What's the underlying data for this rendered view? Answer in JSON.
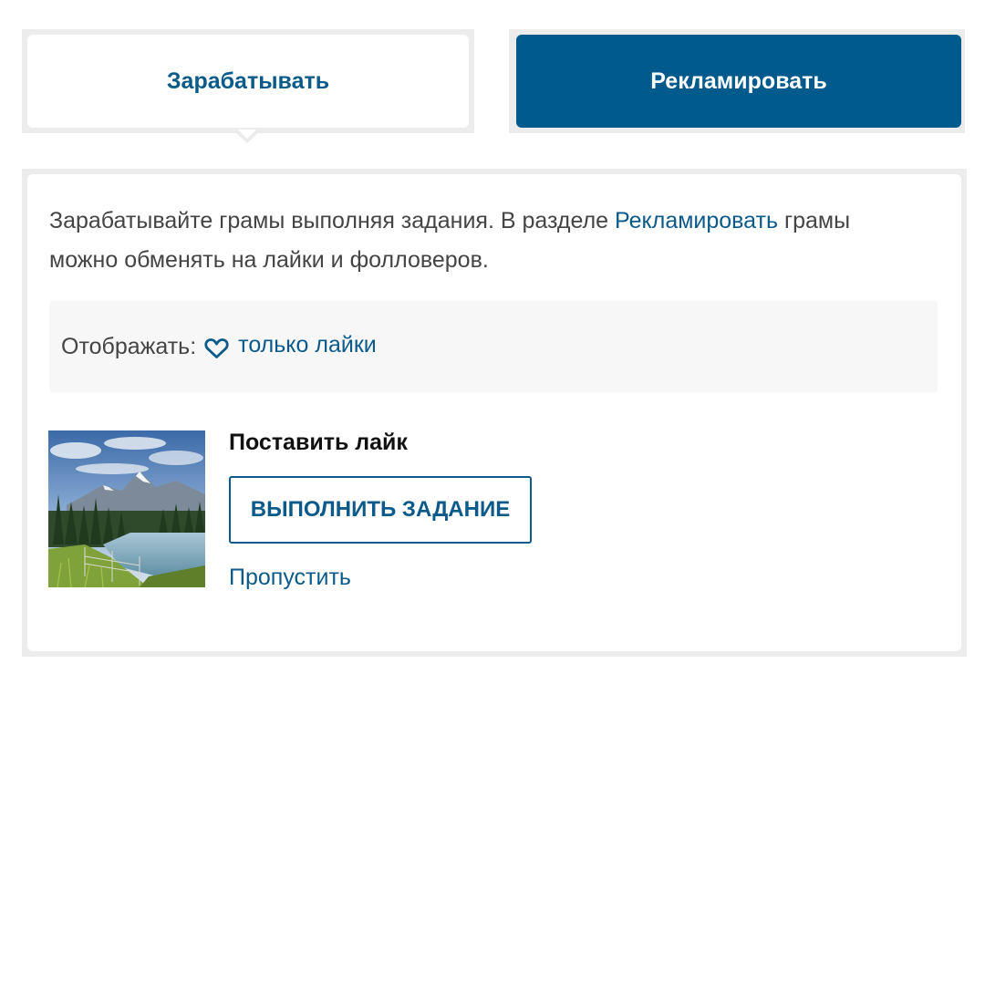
{
  "tabs": {
    "earn_label": "Зарабатывать",
    "advertise_label": "Рекламировать",
    "active": "earn"
  },
  "intro": {
    "text_before": "Зарабатывайте грамы выполняя задания. В разделе ",
    "link_text": "Рекламировать",
    "text_after": " грамы можно обменять на лайки и фолловеров."
  },
  "filter": {
    "label": "Отображать:",
    "icon": "heart-outline-icon",
    "value": "только лайки"
  },
  "task": {
    "title": "Поставить лайк",
    "action_label": "ВЫПОЛНИТЬ ЗАДАНИЕ",
    "skip_label": "Пропустить",
    "image": "mountain-lake-forest-landscape"
  },
  "colors": {
    "accent": "#005a8c",
    "link": "#0b5a8a",
    "frame": "#ececec",
    "filter_bg": "#f7f7f7",
    "text": "#444444"
  }
}
